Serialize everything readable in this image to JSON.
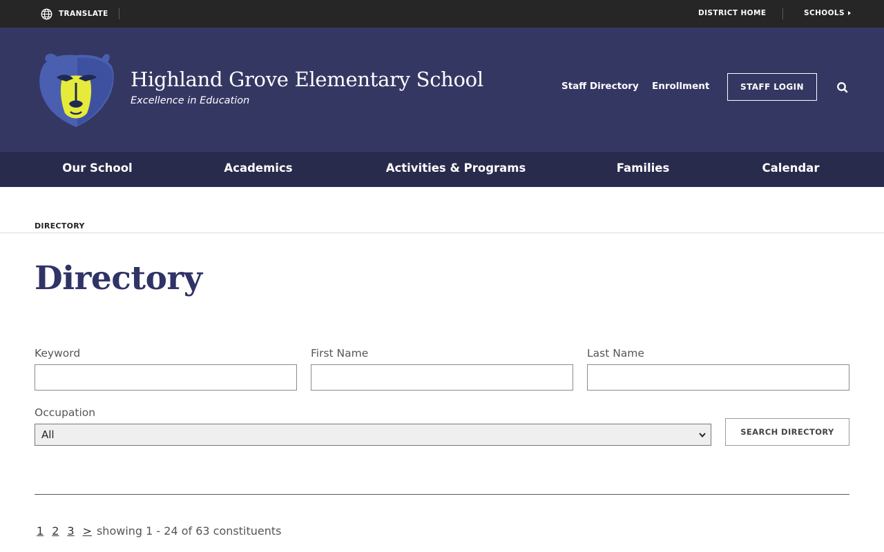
{
  "utility": {
    "translate_label": "TRANSLATE",
    "district_home_label": "DISTRICT HOME",
    "schools_label": "SCHOOLS"
  },
  "header": {
    "school_name": "Highland Grove Elementary School",
    "tagline": "Excellence in Education",
    "links": [
      "Staff Directory",
      "Enrollment"
    ],
    "staff_login_label": "STAFF LOGIN"
  },
  "nav": {
    "items": [
      "Our School",
      "Academics",
      "Activities & Programs",
      "Families",
      "Calendar"
    ]
  },
  "breadcrumb": "DIRECTORY",
  "page_title": "Directory",
  "form": {
    "keyword_label": "Keyword",
    "keyword_value": "",
    "first_name_label": "First Name",
    "first_name_value": "",
    "last_name_label": "Last Name",
    "last_name_value": "",
    "occupation_label": "Occupation",
    "occupation_selected": "All",
    "search_button_label": "SEARCH DIRECTORY"
  },
  "pagination": {
    "pages": [
      "1",
      "2",
      "3"
    ],
    "next": ">",
    "summary": "showing 1 - 24 of 63 constituents"
  },
  "colors": {
    "utility_bar": "#262626",
    "header_bg": "#353763",
    "nav_bg": "#292b4d",
    "title_color": "#2f3366",
    "mascot_blue": "#4a5fb0",
    "mascot_yellow": "#e6ea3a"
  },
  "icons": {
    "translate": "globe-icon",
    "search": "search-icon",
    "schools": "caret-right-icon",
    "select": "chevron-down-icon",
    "logo": "bear-mascot-logo"
  }
}
